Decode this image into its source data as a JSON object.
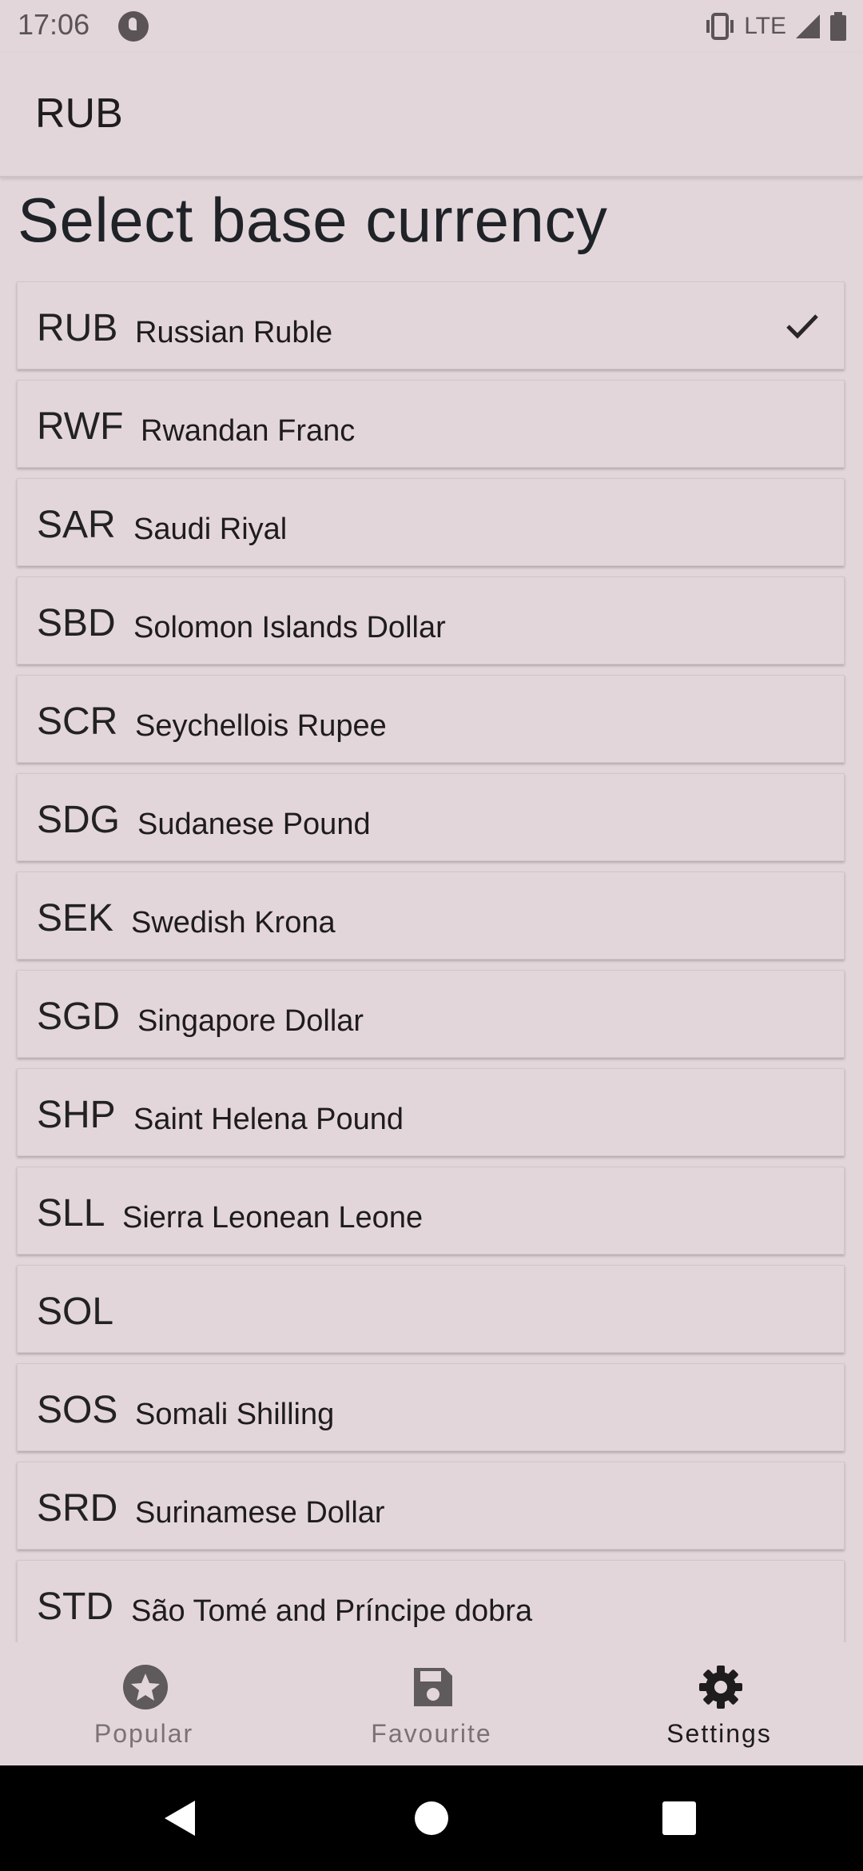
{
  "status_bar": {
    "time": "17:06",
    "network": "LTE"
  },
  "app_bar": {
    "title": "RUB"
  },
  "page": {
    "heading": "Select base currency"
  },
  "currencies": [
    {
      "code": "RUB",
      "name": "Russian Ruble",
      "selected": true
    },
    {
      "code": "RWF",
      "name": "Rwandan Franc",
      "selected": false
    },
    {
      "code": "SAR",
      "name": "Saudi Riyal",
      "selected": false
    },
    {
      "code": "SBD",
      "name": "Solomon Islands Dollar",
      "selected": false
    },
    {
      "code": "SCR",
      "name": "Seychellois Rupee",
      "selected": false
    },
    {
      "code": "SDG",
      "name": "Sudanese Pound",
      "selected": false
    },
    {
      "code": "SEK",
      "name": "Swedish Krona",
      "selected": false
    },
    {
      "code": "SGD",
      "name": "Singapore Dollar",
      "selected": false
    },
    {
      "code": "SHP",
      "name": "Saint Helena Pound",
      "selected": false
    },
    {
      "code": "SLL",
      "name": "Sierra Leonean Leone",
      "selected": false
    },
    {
      "code": "SOL",
      "name": "",
      "selected": false
    },
    {
      "code": "SOS",
      "name": "Somali Shilling",
      "selected": false
    },
    {
      "code": "SRD",
      "name": "Surinamese Dollar",
      "selected": false
    },
    {
      "code": "STD",
      "name": "São Tomé and Príncipe dobra",
      "selected": false
    }
  ],
  "bottom_nav": {
    "items": [
      {
        "label": "Popular",
        "icon": "star-icon",
        "active": false
      },
      {
        "label": "Favourite",
        "icon": "save-icon",
        "active": false
      },
      {
        "label": "Settings",
        "icon": "gear-icon",
        "active": true
      }
    ]
  },
  "colors": {
    "background": "#e3d6da",
    "text": "#1e1c1d",
    "inactive_nav": "#7a7274"
  }
}
